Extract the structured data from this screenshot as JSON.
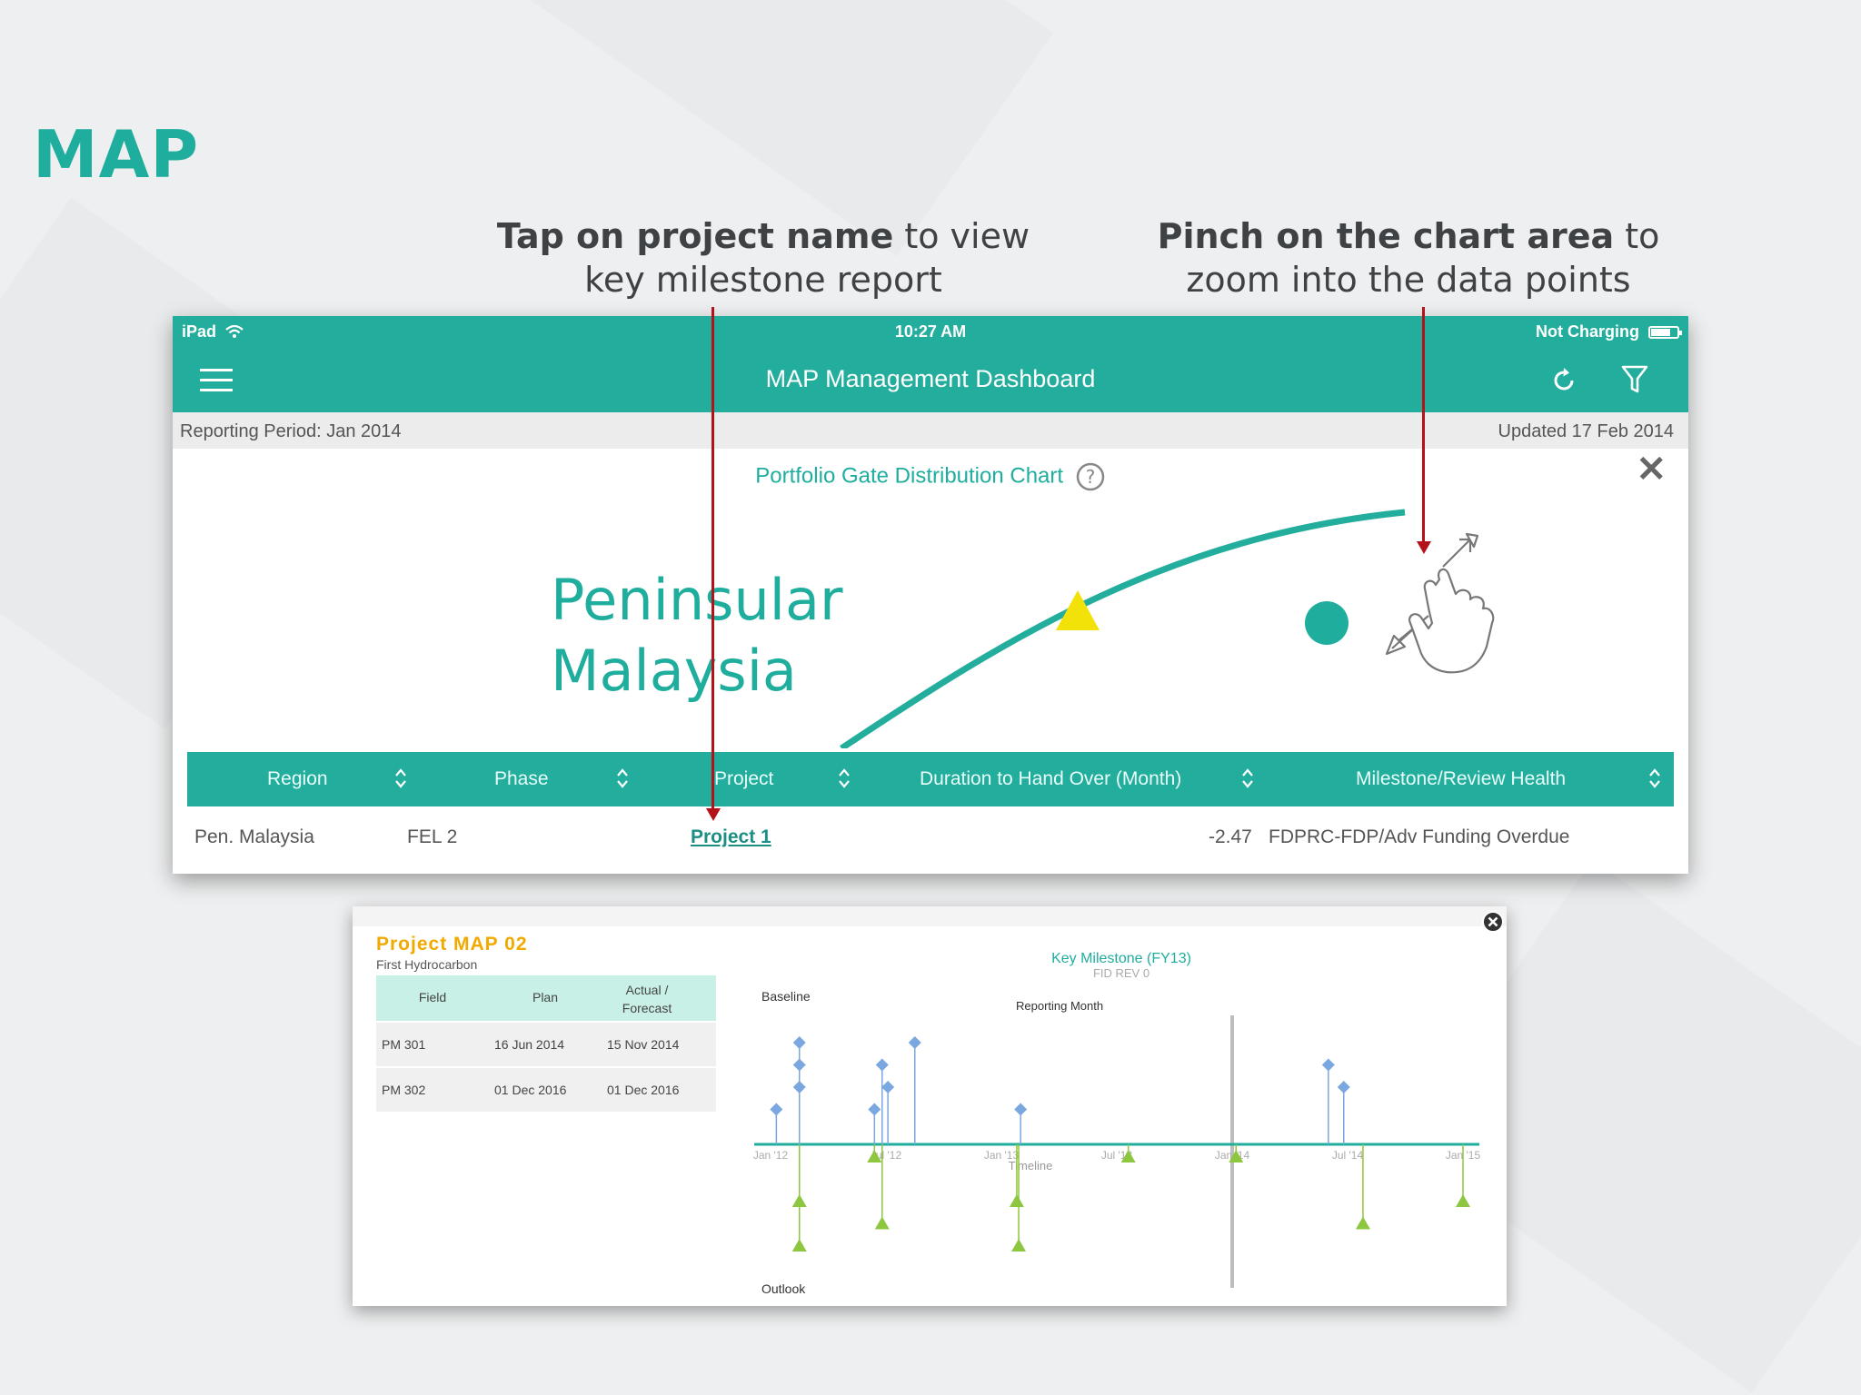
{
  "slide": {
    "title": "MAP",
    "callout_1_bold": "Tap on project name",
    "callout_1_rest": " to view key milestone report",
    "callout_2_bold": "Pinch on the chart area",
    "callout_2_rest": " to zoom into the data points"
  },
  "statusbar": {
    "device": "iPad",
    "time": "10:27 AM",
    "battery_status": "Not Charging"
  },
  "navbar": {
    "title": "MAP Management Dashboard"
  },
  "period": {
    "reporting": "Reporting Period: Jan 2014",
    "updated": "Updated 17 Feb 2014"
  },
  "chart_panel": {
    "title": "Portfolio Gate Distribution Chart",
    "region_line1": "Peninsular",
    "region_line2": "Malaysia",
    "colors": {
      "accent": "#22ad9c",
      "marker_triangle": "#f2e20a",
      "marker_circle": "#1fae9e"
    }
  },
  "table": {
    "headers": [
      "Region",
      "Phase",
      "Project",
      "Duration to Hand Over (Month)",
      "Milestone/Review Health"
    ],
    "rows": [
      {
        "region": "Pen. Malaysia",
        "phase": "FEL 2",
        "project": "Project 1",
        "duration": "-2.47",
        "health": "FDPRC-FDP/Adv Funding Overdue"
      }
    ]
  },
  "popup": {
    "title": "Project MAP 02",
    "subtitle": "First Hydrocarbon",
    "table_headers": [
      "Field",
      "Plan",
      "Actual / Forecast"
    ],
    "table_rows": [
      {
        "field": "PM 301",
        "plan": "16 Jun 2014",
        "actual": "15 Nov 2014"
      },
      {
        "field": "PM 302",
        "plan": "01 Dec 2016",
        "actual": "01 Dec 2016"
      }
    ]
  },
  "chart_data": {
    "type": "scatter",
    "title": "Key Milestone (FY13)",
    "subtitle": "FID REV 0",
    "xlabel": "Timeline",
    "upper_label": "Baseline",
    "lower_label": "Outlook",
    "annotation": "Reporting Month",
    "reporting_month": "Jan '14",
    "x_ticks": [
      "Jan '12",
      "Jul '12",
      "Jan '13",
      "Jul '13",
      "Jan '14",
      "Jul '14",
      "Jan '15"
    ],
    "series": [
      {
        "name": "Baseline",
        "color": "#7aa7df",
        "marker": "diamond",
        "points": [
          {
            "x": 0.3,
            "level": 1
          },
          {
            "x": 1.5,
            "level": 4
          },
          {
            "x": 1.5,
            "level": 3
          },
          {
            "x": 1.5,
            "level": 2
          },
          {
            "x": 5.4,
            "level": 1
          },
          {
            "x": 5.8,
            "level": 3
          },
          {
            "x": 6.1,
            "level": 2
          },
          {
            "x": 7.5,
            "level": 4
          },
          {
            "x": 13.0,
            "level": 1
          },
          {
            "x": 29.0,
            "level": 3
          },
          {
            "x": 29.8,
            "level": 2
          }
        ]
      },
      {
        "name": "Outlook",
        "color": "#8dc63f",
        "marker": "triangle",
        "points": [
          {
            "x": 1.5,
            "level": 2
          },
          {
            "x": 1.5,
            "level": 4
          },
          {
            "x": 5.4,
            "level": 0
          },
          {
            "x": 5.8,
            "level": 3
          },
          {
            "x": 12.8,
            "level": 2
          },
          {
            "x": 12.9,
            "level": 4
          },
          {
            "x": 18.6,
            "level": 0
          },
          {
            "x": 24.2,
            "level": 0
          },
          {
            "x": 30.8,
            "level": 3
          },
          {
            "x": 36.0,
            "level": 2
          }
        ]
      }
    ]
  }
}
